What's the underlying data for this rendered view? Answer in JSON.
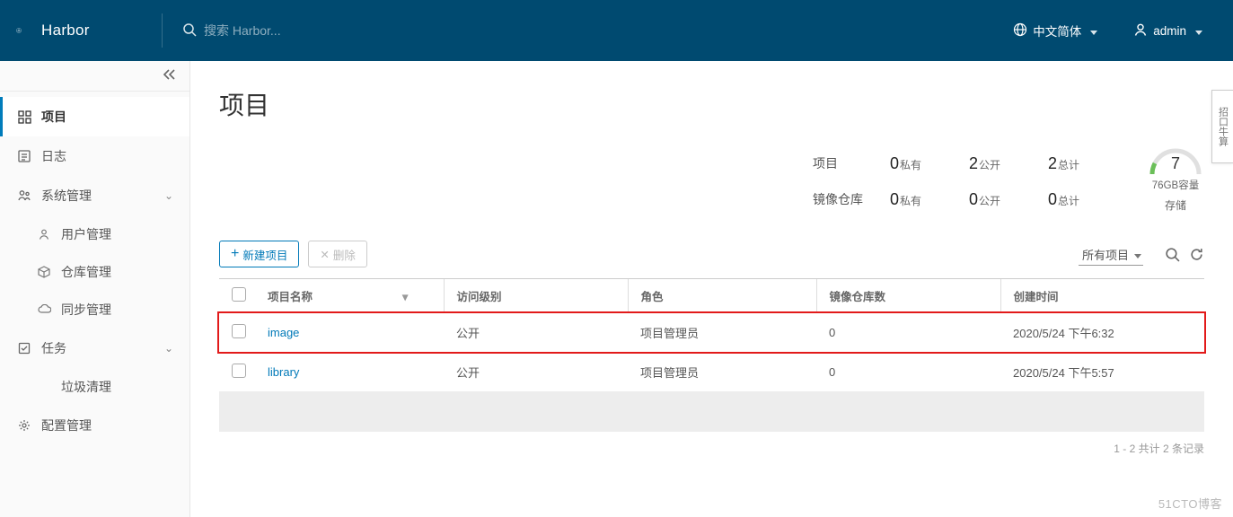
{
  "header": {
    "brand": "Harbor",
    "search_placeholder": "搜索 Harbor...",
    "language_label": "中文简体",
    "user_label": "admin"
  },
  "sidebar": {
    "items": {
      "projects": "项目",
      "logs": "日志",
      "sysadmin": "系统管理",
      "users": "用户管理",
      "repos": "仓库管理",
      "sync": "同步管理",
      "tasks": "任务",
      "gc": "垃圾清理",
      "config": "配置管理"
    }
  },
  "page": {
    "title": "项目"
  },
  "summary": {
    "row_labels": {
      "projects": "项目",
      "repos": "镜像仓库"
    },
    "col_labels": {
      "private": "私有",
      "public": "公开",
      "total": "总计"
    },
    "projects": {
      "private": "0",
      "public": "2",
      "total": "2"
    },
    "repos": {
      "private": "0",
      "public": "0",
      "total": "0"
    },
    "storage": {
      "value": "7",
      "capacity": "76GB容量",
      "label": "存储"
    }
  },
  "toolbar": {
    "new_label": "新建项目",
    "delete_label": "删除",
    "filter_label": "所有项目"
  },
  "table": {
    "headers": {
      "name": "项目名称",
      "access": "访问级别",
      "role": "角色",
      "repo_count": "镜像仓库数",
      "created": "创建时间"
    },
    "rows": [
      {
        "name": "image",
        "access": "公开",
        "role": "项目管理员",
        "repo_count": "0",
        "created": "2020/5/24 下午6:32",
        "highlight": true
      },
      {
        "name": "library",
        "access": "公开",
        "role": "项目管理员",
        "repo_count": "0",
        "created": "2020/5/24 下午5:57",
        "highlight": false
      }
    ],
    "pager": "1 - 2 共计 2 条记录"
  },
  "side_tab": "招口牛算",
  "watermark": "51CTO博客"
}
